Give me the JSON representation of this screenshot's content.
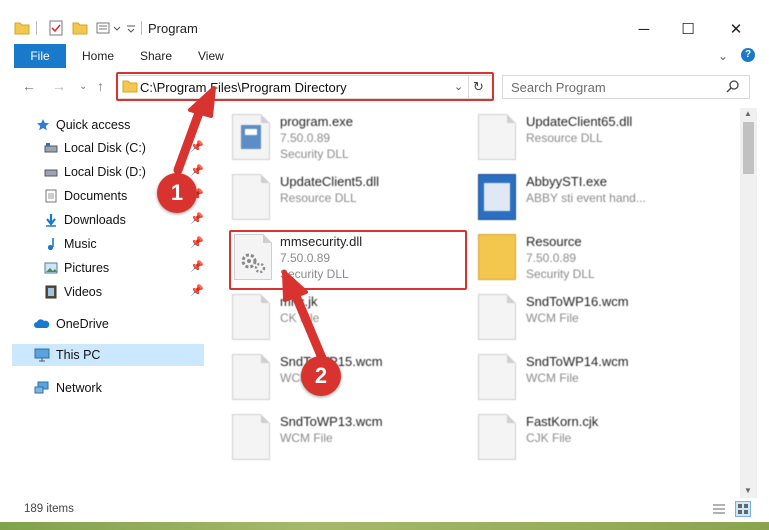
{
  "window": {
    "title": "Program",
    "controls": {
      "minimize": "─",
      "maximize": "☐",
      "close": "✕"
    }
  },
  "ribbon": {
    "tabs": [
      "File",
      "Home",
      "Share",
      "View"
    ]
  },
  "address": {
    "path": "C:\\Program Files\\Program Directory",
    "search_placeholder": "Search Program"
  },
  "sidebar": {
    "items": [
      {
        "label": "Quick access",
        "icon": "star-icon"
      },
      {
        "label": "Local Disk (C:)",
        "icon": "drive-icon",
        "pinned": true
      },
      {
        "label": "Local Disk (D:)",
        "icon": "drive-icon",
        "pinned": true
      },
      {
        "label": "Documents",
        "icon": "documents-icon",
        "pinned": true
      },
      {
        "label": "Downloads",
        "icon": "download-icon",
        "pinned": true
      },
      {
        "label": "Music",
        "icon": "music-icon",
        "pinned": true
      },
      {
        "label": "Pictures",
        "icon": "pictures-icon",
        "pinned": true
      },
      {
        "label": "Videos",
        "icon": "videos-icon",
        "pinned": true
      },
      {
        "label": "OneDrive",
        "icon": "cloud-icon"
      },
      {
        "label": "This PC",
        "icon": "computer-icon",
        "selected": true
      },
      {
        "label": "Network",
        "icon": "network-icon"
      }
    ]
  },
  "files": [
    {
      "name": "program.exe",
      "line2": "7.50.0.89",
      "line3": "Security DLL"
    },
    {
      "name": "UpdateClient65.dll",
      "line2": "Resource DLL",
      "line3": ""
    },
    {
      "name": "UpdateClient5.dll",
      "line2": "Resource DLL",
      "line3": ""
    },
    {
      "name": "AbbyySTI.exe",
      "line2": "ABBY sti event hand...",
      "line3": ""
    },
    {
      "name": "mmsecurity.dll",
      "line2": "7.50.0.89",
      "line3": "Security DLL"
    },
    {
      "name": "Resource",
      "line2": "7.50.0.89",
      "line3": "Security DLL"
    },
    {
      "name": "mnc.jk",
      "line2": "CK File",
      "line3": ""
    },
    {
      "name": "SndToWP16.wcm",
      "line2": "WCM File",
      "line3": ""
    },
    {
      "name": "SndToWP15.wcm",
      "line2": "WCM File",
      "line3": ""
    },
    {
      "name": "SndToWP14.wcm",
      "line2": "WCM File",
      "line3": ""
    },
    {
      "name": "SndToWP13.wcm",
      "line2": "WCM File",
      "line3": ""
    },
    {
      "name": "FastKorn.cjk",
      "line2": "CJK File",
      "line3": ""
    }
  ],
  "status": {
    "count": "189 items"
  },
  "callouts": {
    "one": "1",
    "two": "2"
  },
  "colors": {
    "accent": "#1979ca",
    "highlight": "#d8332f",
    "selected_bg": "#cce8ff"
  }
}
